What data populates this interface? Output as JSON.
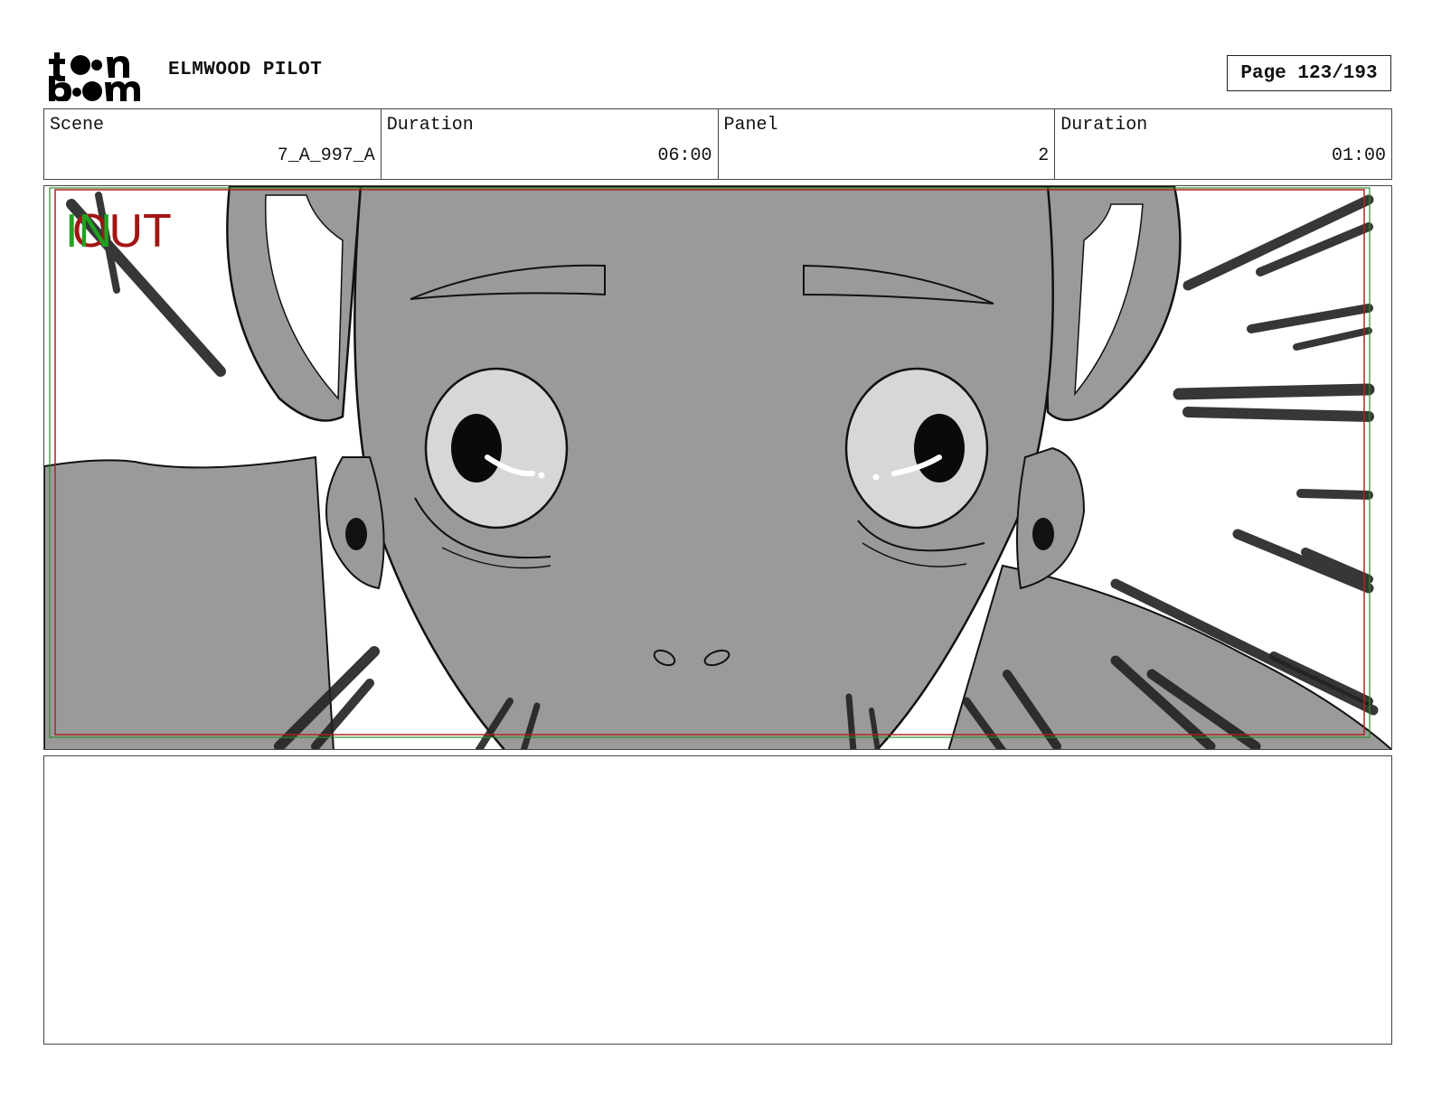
{
  "header": {
    "logo_text": "toon boom",
    "project_title": "ELMWOOD PILOT",
    "page_label": "Page 123/193"
  },
  "info": {
    "scene_label": "Scene",
    "scene_value": "7_A_997_A",
    "scene_duration_label": "Duration",
    "scene_duration_value": "06:00",
    "panel_label": "Panel",
    "panel_value": "2",
    "panel_duration_label": "Duration",
    "panel_duration_value": "01:00"
  },
  "panel_overlay": {
    "in_label": "IN",
    "out_label": "OUT",
    "in_color": "#1fa31f",
    "out_color": "#a31515"
  },
  "notes": {
    "text": ""
  }
}
